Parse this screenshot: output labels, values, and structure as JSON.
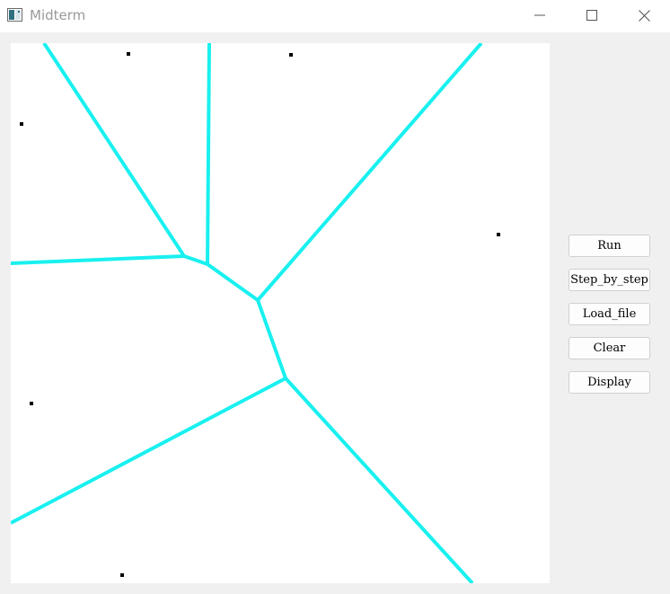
{
  "window": {
    "title": "Midterm"
  },
  "icons": {
    "app": "app-window-icon",
    "minimize": "minimize-icon",
    "maximize": "maximize-icon",
    "close": "close-icon"
  },
  "colors": {
    "edge": "#19f0f0",
    "point": "#000000",
    "canvas": "#ffffff"
  },
  "buttons": {
    "run": "Run",
    "step_by_step": "Step_by_step",
    "load_file": "Load_file",
    "clear": "Clear",
    "display": "Display"
  }
}
